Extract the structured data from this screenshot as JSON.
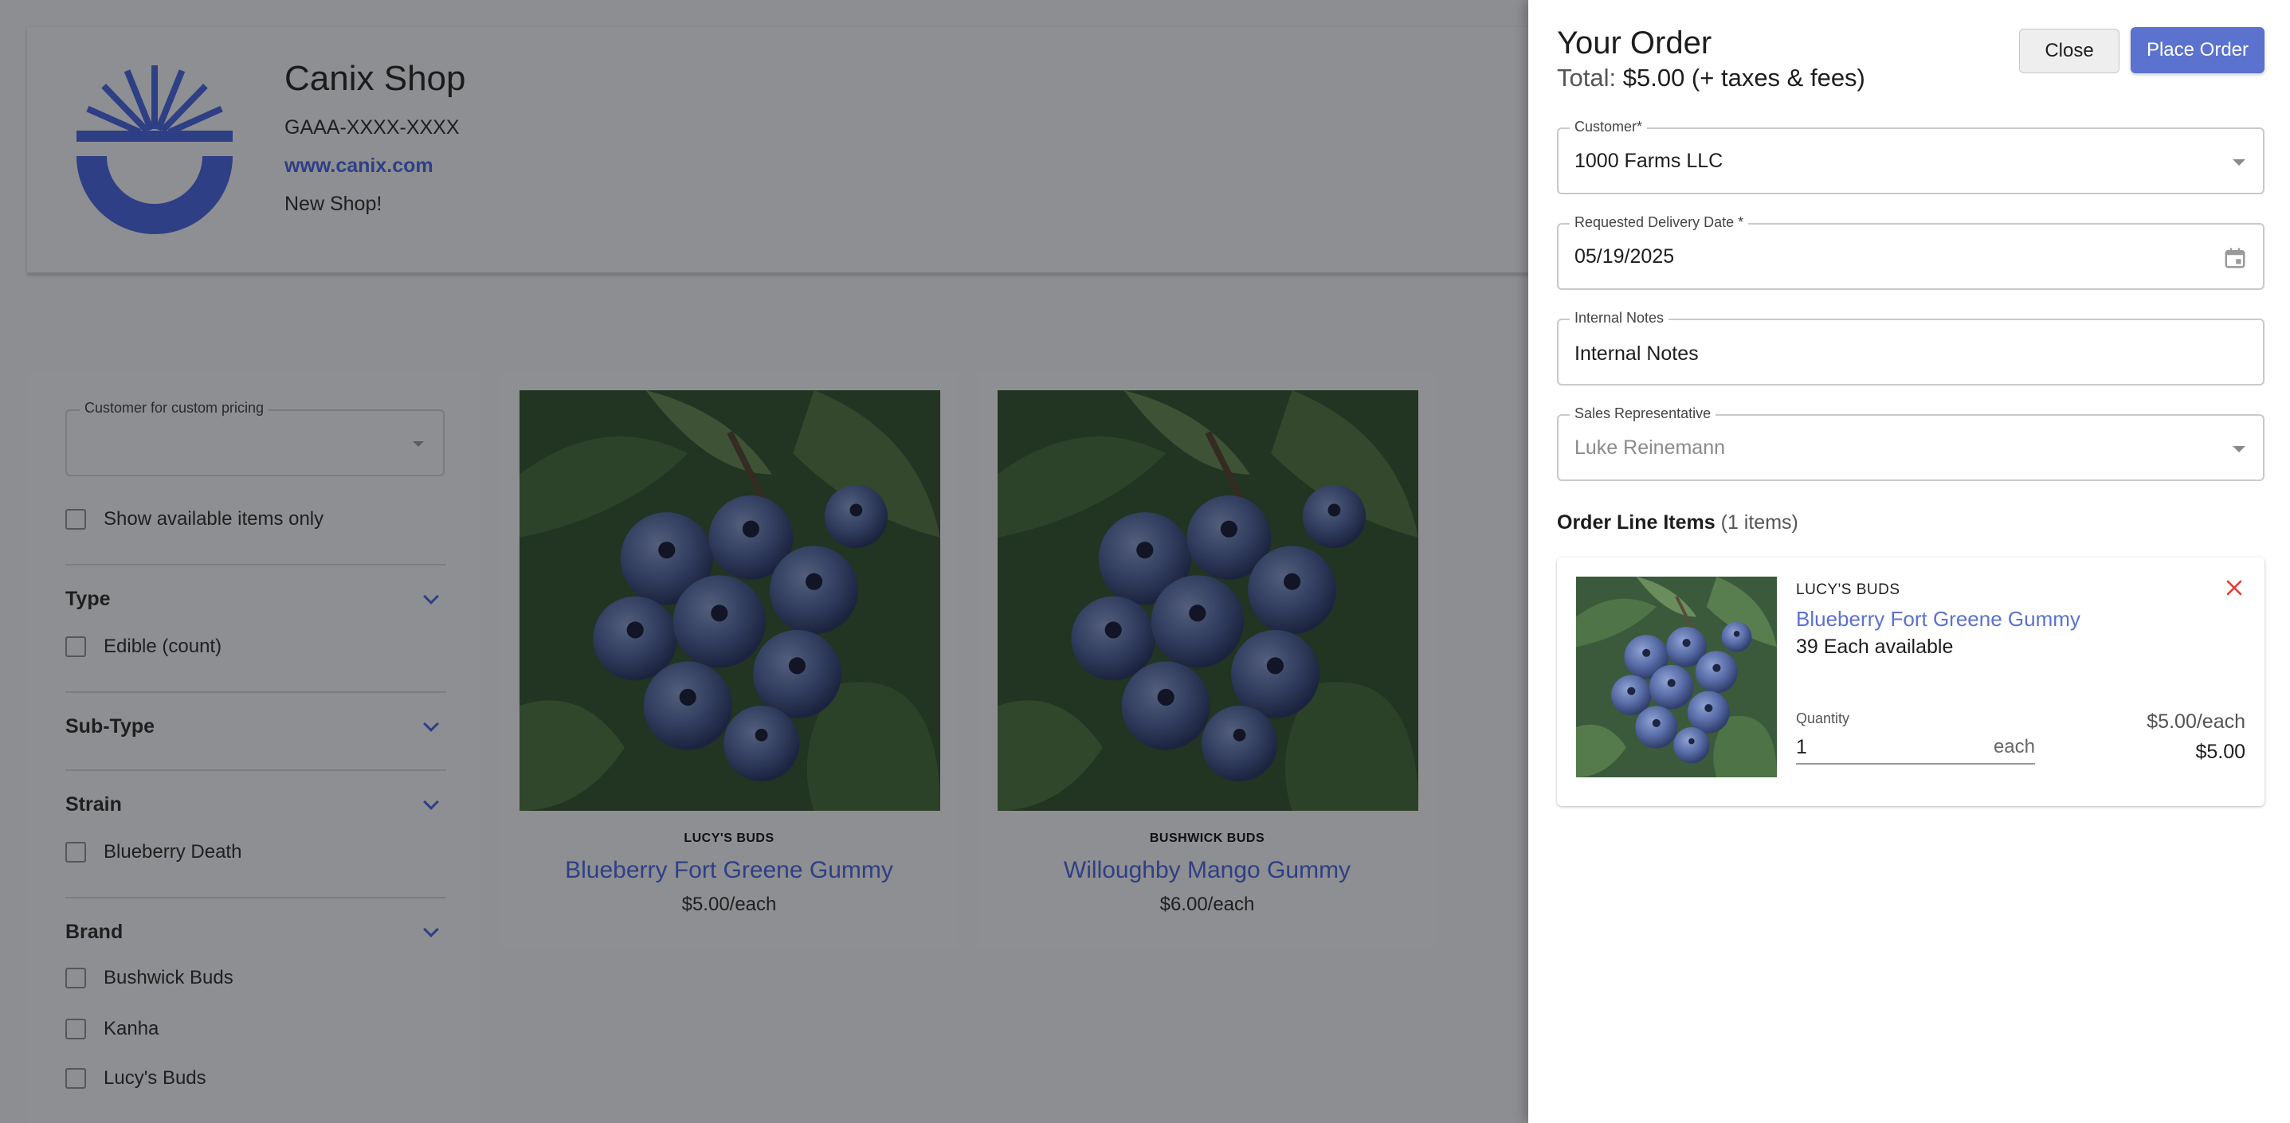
{
  "shop": {
    "name": "Canix Shop",
    "license": "GAAA-XXXX-XXXX",
    "url": "www.canix.com",
    "description": "New Shop!"
  },
  "filters": {
    "custom_pricing_label": "Customer for custom pricing",
    "custom_pricing_value": "",
    "show_available_label": "Show available items only",
    "sections": [
      {
        "title": "Type",
        "options": [
          "Edible (count)"
        ]
      },
      {
        "title": "Sub-Type",
        "options": []
      },
      {
        "title": "Strain",
        "options": [
          "Blueberry Death"
        ]
      },
      {
        "title": "Brand",
        "options": [
          "Bushwick Buds",
          "Kanha",
          "Lucy's Buds"
        ]
      }
    ]
  },
  "products": [
    {
      "brand": "LUCY'S BUDS",
      "name": "Blueberry Fort Greene Gummy",
      "price": "$5.00/each"
    },
    {
      "brand": "BUSHWICK BUDS",
      "name": "Willoughby Mango Gummy",
      "price": "$6.00/each"
    }
  ],
  "order": {
    "title": "Your Order",
    "total_label": "Total:",
    "total_value": "$5.00 (+ taxes & fees)",
    "close_label": "Close",
    "place_label": "Place Order",
    "customer": {
      "label": "Customer*",
      "value": "1000 Farms LLC"
    },
    "delivery_date": {
      "label": "Requested Delivery Date *",
      "value": "05/19/2025"
    },
    "internal_notes": {
      "label": "Internal Notes",
      "placeholder": "Internal Notes"
    },
    "sales_rep": {
      "label": "Sales Representative",
      "value": "Luke Reinemann"
    },
    "line_items_title": "Order Line Items",
    "line_items_count": "(1 items)",
    "line_items": [
      {
        "brand": "LUCY'S BUDS",
        "name": "Blueberry Fort Greene Gummy",
        "availability": "39 Each available",
        "quantity_label": "Quantity",
        "quantity": "1",
        "unit": "each",
        "unit_price": "$5.00/each",
        "line_total": "$5.00"
      }
    ]
  },
  "colors": {
    "accent": "#5b72cf",
    "overlay_page": "#8e8f92",
    "remove_icon": "#e53935",
    "link_dim": "#2e3f86"
  },
  "icons": {
    "logo": "canix-sunrise-logo",
    "dropdown": "caret-down-icon",
    "calendar": "calendar-icon",
    "remove": "close-x-icon",
    "collapse": "chevron-down-icon"
  }
}
